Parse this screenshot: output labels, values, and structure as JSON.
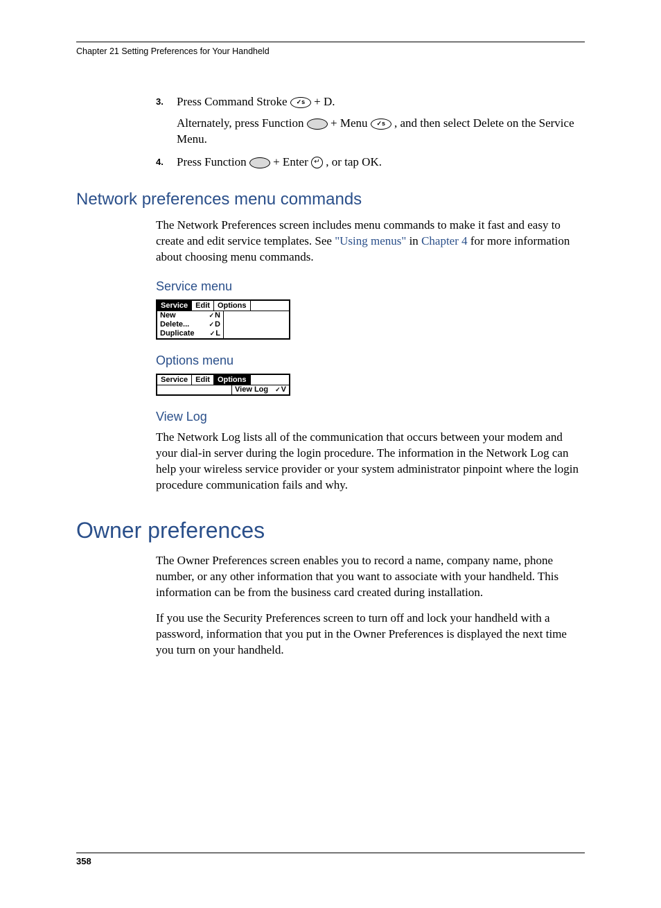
{
  "header": {
    "running_head": "Chapter 21    Setting Preferences for Your Handheld"
  },
  "steps": {
    "s3": {
      "num": "3.",
      "text_a": "Press Command Stroke ",
      "text_b": " + D.",
      "alt_a": "Alternately, press Function ",
      "alt_b": " + Menu ",
      "alt_c": ", and then select Delete on the Service Menu."
    },
    "s4": {
      "num": "4.",
      "text_a": "Press Function ",
      "text_b": " + Enter ",
      "text_c": ", or tap OK."
    }
  },
  "sections": {
    "network_menu": {
      "title": "Network preferences menu commands",
      "body_a": "The Network Preferences screen includes menu commands to make it fast and easy to create and edit service templates. See ",
      "link1": "\"Using menus\"",
      "body_b": " in ",
      "link2": "Chapter 4",
      "body_c": " for more information about choosing menu commands."
    },
    "service_menu": {
      "title": "Service menu",
      "tabs": {
        "service": "Service",
        "edit": "Edit",
        "options": "Options"
      },
      "items": [
        {
          "label": "New",
          "shortcut": "N"
        },
        {
          "label": "Delete...",
          "shortcut": "D"
        },
        {
          "label": "Duplicate",
          "shortcut": "L"
        }
      ]
    },
    "options_menu": {
      "title": "Options menu",
      "tabs": {
        "service": "Service",
        "edit": "Edit",
        "options": "Options"
      },
      "item": {
        "label": "View Log",
        "shortcut": "V"
      }
    },
    "view_log": {
      "title": "View Log",
      "body": "The Network Log lists all of the communication that occurs between your modem and your dial-in server during the login procedure. The information in the Network Log can help your wireless service provider or your system administrator pinpoint where the login procedure communication fails and why."
    },
    "owner": {
      "title": "Owner preferences",
      "p1": "The Owner Preferences screen enables you to record a name, company name, phone number, or any other information that you want to associate with your handheld. This information can be from the business card created during installation.",
      "p2": "If you use the Security Preferences screen to turn off and lock your handheld with a password, information that you put in the Owner Preferences is displayed the next time you turn on your handheld."
    }
  },
  "footer": {
    "page": "358"
  }
}
